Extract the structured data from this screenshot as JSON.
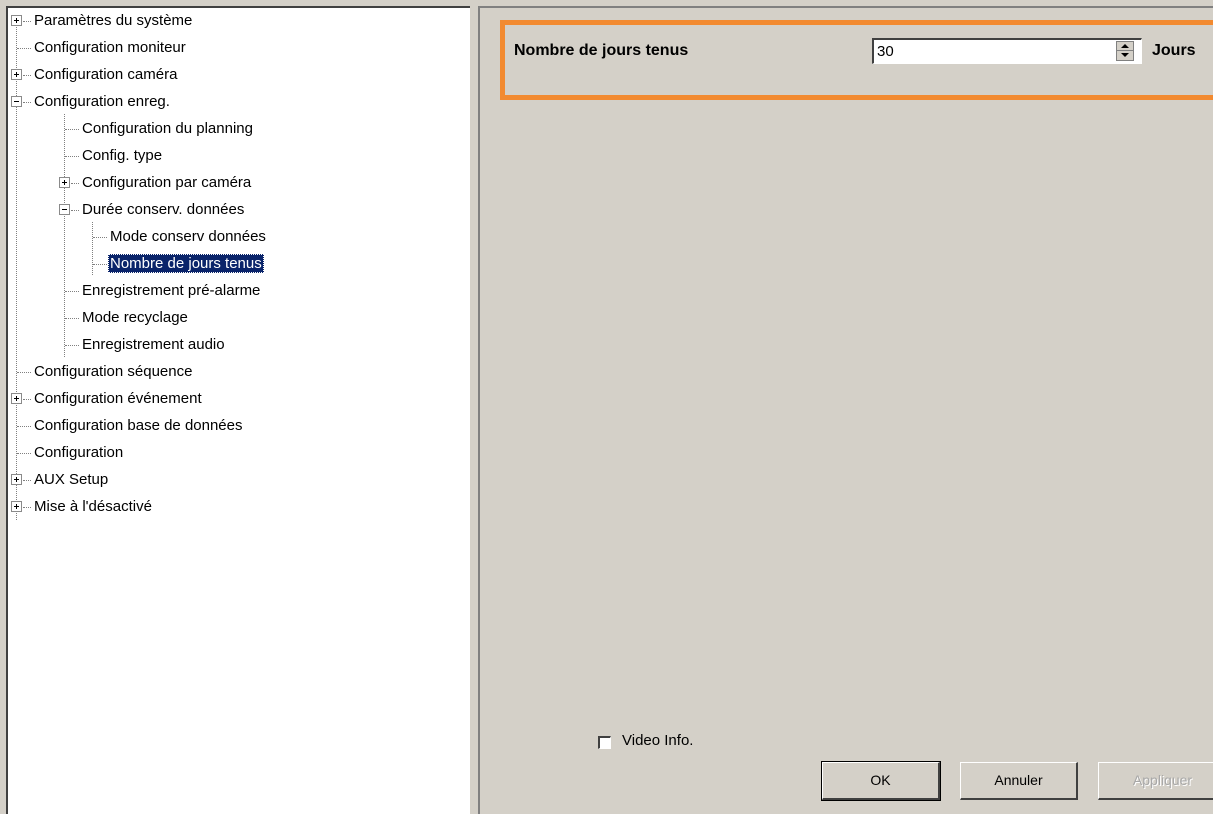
{
  "tree": {
    "items": [
      {
        "label": "Paramètres du système",
        "expander": "plus"
      },
      {
        "label": "Configuration moniteur",
        "expander": "none"
      },
      {
        "label": "Configuration caméra",
        "expander": "plus"
      },
      {
        "label": "Configuration enreg.",
        "expander": "minus"
      },
      {
        "label": "Configuration du planning",
        "expander": "none"
      },
      {
        "label": "Config. type",
        "expander": "none"
      },
      {
        "label": "Configuration par caméra",
        "expander": "plus"
      },
      {
        "label": "Durée conserv. données",
        "expander": "minus"
      },
      {
        "label": "Mode conserv données",
        "expander": "none"
      },
      {
        "label": "Nombre de jours tenus",
        "expander": "none",
        "selected": true
      },
      {
        "label": "Enregistrement pré-alarme",
        "expander": "none"
      },
      {
        "label": "Mode recyclage",
        "expander": "none"
      },
      {
        "label": "Enregistrement audio",
        "expander": "none"
      },
      {
        "label": "Configuration séquence",
        "expander": "none"
      },
      {
        "label": "Configuration événement",
        "expander": "plus"
      },
      {
        "label": "Configuration base de données",
        "expander": "none"
      },
      {
        "label": "Configuration",
        "expander": "none"
      },
      {
        "label": "AUX Setup",
        "expander": "plus"
      },
      {
        "label": "Mise à l'désactivé",
        "expander": "plus"
      }
    ]
  },
  "settings": {
    "field_label": "Nombre de jours tenus",
    "days_value": "30",
    "unit_label": "Jours",
    "highlight_color": "#f28a30",
    "video_info_label": "Video Info.",
    "video_info_checked": false
  },
  "buttons": {
    "ok_label": "OK",
    "cancel_label": "Annuler",
    "apply_label": "Appliquer",
    "apply_enabled": false
  },
  "colors": {
    "selection": "#0a246a",
    "panel": "#d4d0c8"
  }
}
